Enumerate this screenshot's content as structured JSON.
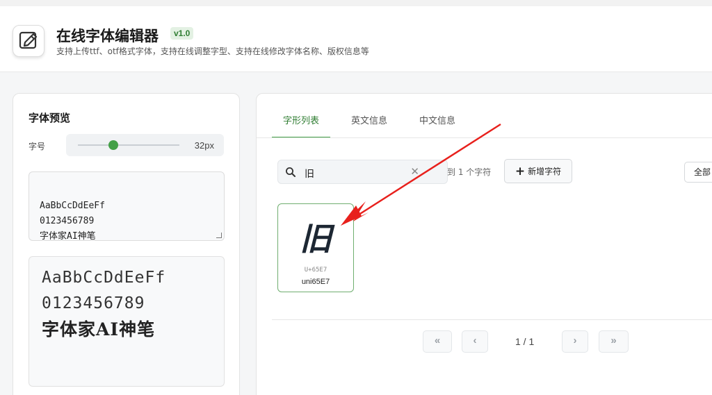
{
  "header": {
    "title": "在线字体编辑器",
    "version": "v1.0",
    "subtitle": "支持上传ttf、otf格式字体，支持在线调整字型、支持在线修改字体名称、版权信息等"
  },
  "preview_panel": {
    "title": "字体预览",
    "size_label": "字号",
    "size_value": "32px",
    "slider_fraction": 0.35,
    "input_text": "AaBbCcDdEeFf\n0123456789\n字体家AI神笔",
    "preview_lines": [
      "AaBbCcDdEeFf",
      "0123456789",
      "字体家AI神笔"
    ]
  },
  "main_panel": {
    "tabs": [
      {
        "label": "字形列表",
        "active": true
      },
      {
        "label": "英文信息",
        "active": false
      },
      {
        "label": "中文信息",
        "active": false
      }
    ],
    "search_value": "旧",
    "found_text": "到 1 个字符",
    "add_button": "新增字符",
    "all_button": "全部",
    "glyphs": [
      {
        "char": "旧",
        "code": "U+65E7",
        "name": "uni65E7"
      }
    ],
    "pagination": {
      "first": "«",
      "prev": "‹",
      "info": "1 / 1",
      "next": "›",
      "last": "»"
    }
  },
  "colors": {
    "accent": "#43a047",
    "annotation_arrow": "#e8201c"
  }
}
